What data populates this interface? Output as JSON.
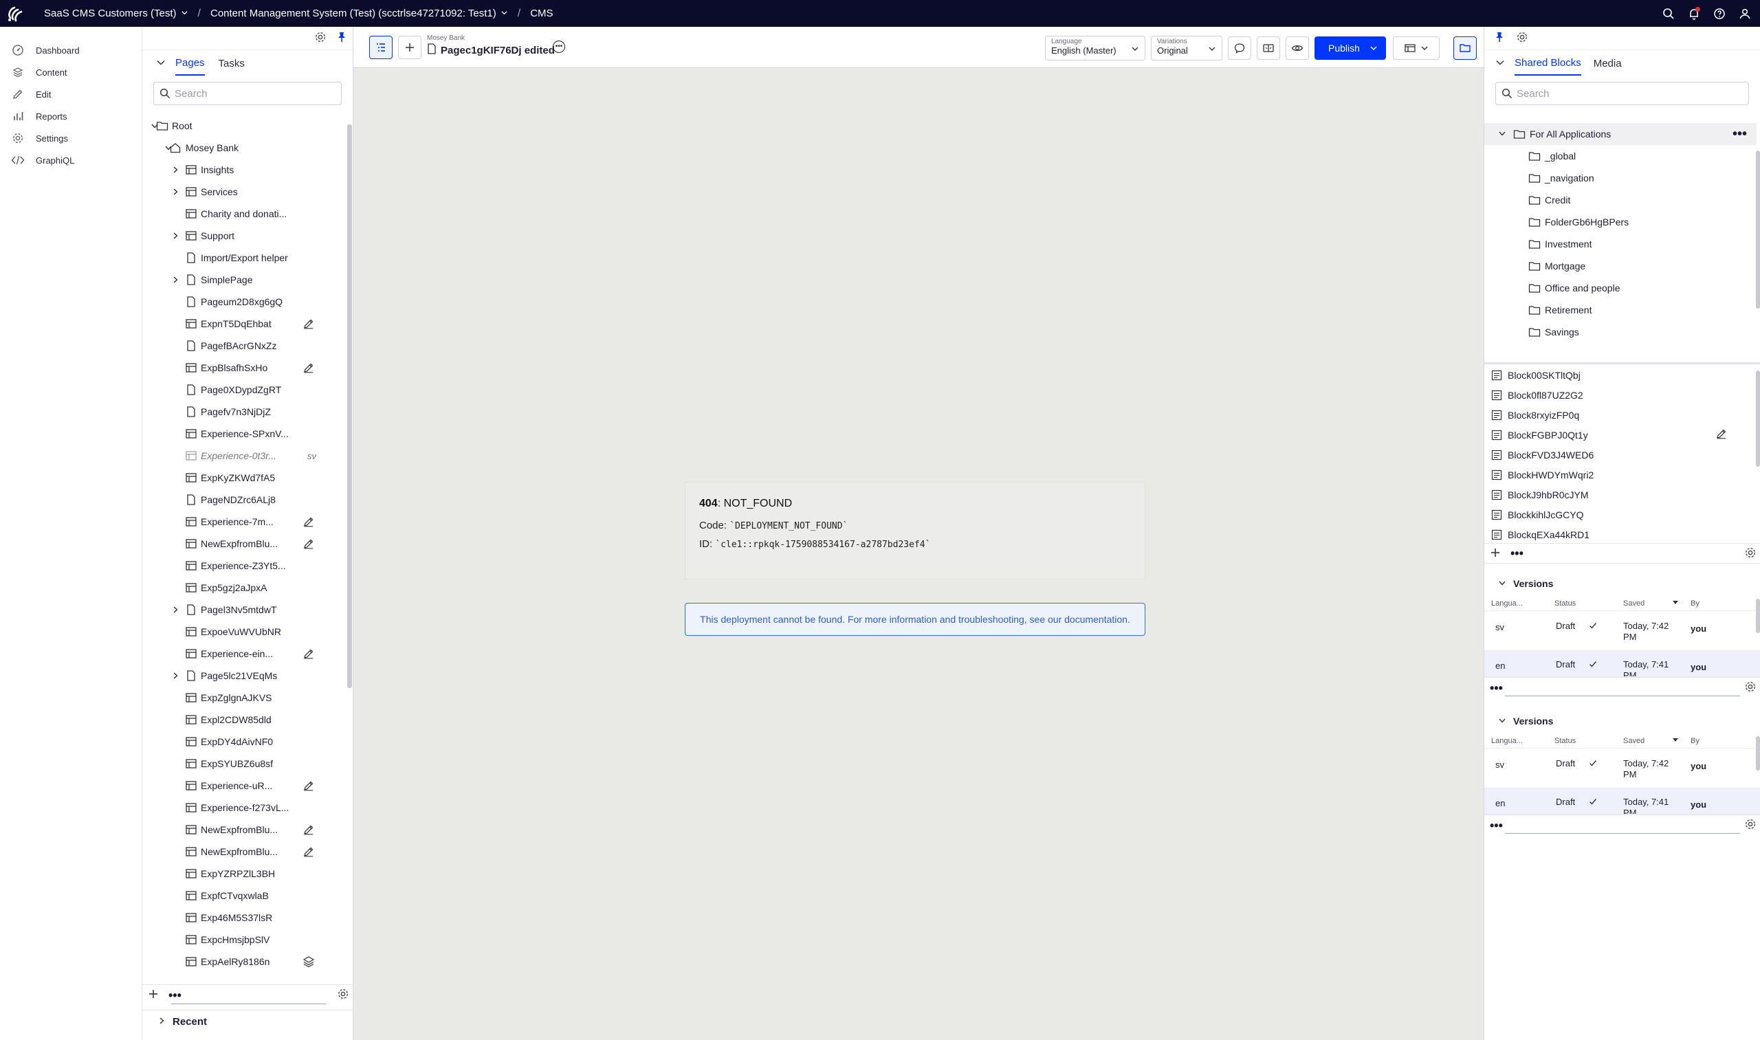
{
  "topbar": {
    "crumbs": [
      {
        "label": "SaaS CMS Customers (Test)",
        "dropdown": true
      },
      {
        "label": "Content Management System (Test) (scctrlse47271092: Test1)",
        "dropdown": true
      },
      {
        "label": "CMS",
        "dropdown": false
      }
    ]
  },
  "leftnav": {
    "items": [
      {
        "label": "Dashboard",
        "icon": "dashboard-icon"
      },
      {
        "label": "Content",
        "icon": "content-icon"
      },
      {
        "label": "Edit",
        "icon": "edit-icon"
      },
      {
        "label": "Reports",
        "icon": "reports-icon"
      },
      {
        "label": "Settings",
        "icon": "settings-icon"
      },
      {
        "label": "GraphiQL",
        "icon": "code-icon"
      }
    ]
  },
  "treepanel": {
    "tabs": {
      "pages": "Pages",
      "tasks": "Tasks"
    },
    "search_placeholder": "Search",
    "recent_label": "Recent",
    "items": [
      {
        "label": "Root",
        "level": 0,
        "icon": "folder",
        "expanded": true
      },
      {
        "label": "Mosey Bank",
        "level": 1,
        "icon": "home",
        "expanded": true
      },
      {
        "label": "Insights",
        "level": 2,
        "icon": "grid",
        "collapsed": true
      },
      {
        "label": "Services",
        "level": 2,
        "icon": "grid",
        "collapsed": true
      },
      {
        "label": "Charity and donati...",
        "level": 2,
        "icon": "grid"
      },
      {
        "label": "Support",
        "level": 2,
        "icon": "grid",
        "collapsed": true
      },
      {
        "label": "Import/Export helper",
        "level": 2,
        "icon": "page"
      },
      {
        "label": "SimplePage",
        "level": 2,
        "icon": "page",
        "collapsed": true
      },
      {
        "label": "Pageum2D8xg6gQ",
        "level": 2,
        "icon": "page"
      },
      {
        "label": "ExpnT5DqEhbat",
        "level": 2,
        "icon": "grid",
        "edit": true
      },
      {
        "label": "PagefBAcrGNxZz",
        "level": 2,
        "icon": "page"
      },
      {
        "label": "ExpBlsafhSxHo",
        "level": 2,
        "icon": "grid",
        "edit": true
      },
      {
        "label": "Page0XDypdZgRT",
        "level": 2,
        "icon": "page"
      },
      {
        "label": "Pagefv7n3NjDjZ",
        "level": 2,
        "icon": "page"
      },
      {
        "label": "Experience-SPxnV...",
        "level": 2,
        "icon": "grid"
      },
      {
        "label": "Experience-0t3r...",
        "level": 2,
        "icon": "grid",
        "italic": true,
        "tag": "sv"
      },
      {
        "label": "ExpKyZKWd7fA5",
        "level": 2,
        "icon": "grid"
      },
      {
        "label": "PageNDZrc6ALj8",
        "level": 2,
        "icon": "page"
      },
      {
        "label": "Experience-7m...",
        "level": 2,
        "icon": "grid",
        "edit": true
      },
      {
        "label": "NewExpfromBlu...",
        "level": 2,
        "icon": "grid",
        "edit": true
      },
      {
        "label": "Experience-Z3Yt5...",
        "level": 2,
        "icon": "grid"
      },
      {
        "label": "Exp5gzj2aJpxA",
        "level": 2,
        "icon": "grid"
      },
      {
        "label": "Pagel3Nv5mtdwT",
        "level": 2,
        "icon": "page",
        "collapsed": true
      },
      {
        "label": "ExpoeVuWVUbNR",
        "level": 2,
        "icon": "grid"
      },
      {
        "label": "Experience-ein...",
        "level": 2,
        "icon": "grid",
        "edit": true
      },
      {
        "label": "Page5lc21VEqMs",
        "level": 2,
        "icon": "page",
        "collapsed": true
      },
      {
        "label": "ExpZglgnAJKVS",
        "level": 2,
        "icon": "grid"
      },
      {
        "label": "Expl2CDW85dld",
        "level": 2,
        "icon": "grid"
      },
      {
        "label": "ExpDY4dAivNF0",
        "level": 2,
        "icon": "grid"
      },
      {
        "label": "ExpSYUBZ6u8sf",
        "level": 2,
        "icon": "grid"
      },
      {
        "label": "Experience-uR...",
        "level": 2,
        "icon": "grid",
        "edit": true
      },
      {
        "label": "Experience-f273vL...",
        "level": 2,
        "icon": "grid"
      },
      {
        "label": "NewExpfromBlu...",
        "level": 2,
        "icon": "grid",
        "edit": true
      },
      {
        "label": "NewExpfromBlu...",
        "level": 2,
        "icon": "grid",
        "edit": true
      },
      {
        "label": "ExpYZRPZlL3BH",
        "level": 2,
        "icon": "grid"
      },
      {
        "label": "ExpfCTvqxwlaB",
        "level": 2,
        "icon": "grid"
      },
      {
        "label": "Exp46M5S37lsR",
        "level": 2,
        "icon": "grid"
      },
      {
        "label": "ExpcHmsjbpSlV",
        "level": 2,
        "icon": "grid"
      },
      {
        "label": "ExpAelRy8186n",
        "level": 2,
        "icon": "grid",
        "layers": true
      }
    ]
  },
  "editor": {
    "parent": "Mosey Bank",
    "title": "Pagec1gKIF76Dj edited",
    "language": {
      "label": "Language",
      "value": "English (Master)"
    },
    "variations": {
      "label": "Variations",
      "value": "Original"
    },
    "publish_label": "Publish",
    "error": {
      "code_num": "404",
      "title_rest": ": NOT_FOUND",
      "code_label": "Code: ",
      "code_value": "`DEPLOYMENT_NOT_FOUND`",
      "id_label": "ID: ",
      "id_value": "`cle1::rpkqk-1759088534167-a2787bd23ef4`",
      "note": "This deployment cannot be found. For more information and troubleshooting, see our documentation."
    }
  },
  "rightpanel": {
    "tabs": {
      "shared": "Shared Blocks",
      "media": "Media"
    },
    "search_placeholder": "Search",
    "folders": [
      {
        "label": "For All Applications",
        "root": true
      },
      {
        "label": "_global"
      },
      {
        "label": "_navigation"
      },
      {
        "label": "Credit"
      },
      {
        "label": "FolderGb6HgBPers"
      },
      {
        "label": "Investment"
      },
      {
        "label": "Mortgage"
      },
      {
        "label": "Office and people"
      },
      {
        "label": "Retirement"
      },
      {
        "label": "Savings"
      }
    ],
    "blocks": [
      {
        "label": "Block00SKTltQbj"
      },
      {
        "label": "Block0fl87UZ2G2"
      },
      {
        "label": "Block8rxyizFP0q"
      },
      {
        "label": "BlockFGBPJ0Qt1y",
        "edit": true
      },
      {
        "label": "BlockFVD3J4WED6"
      },
      {
        "label": "BlockHWDYmWqri2"
      },
      {
        "label": "BlockJ9hbR0cJYM"
      },
      {
        "label": "BlockkihlJcGCYQ"
      },
      {
        "label": "BlockqEXa44kRD1"
      }
    ],
    "versions_title": "Versions",
    "version_cols": {
      "lang": "Langua...",
      "status": "Status",
      "saved": "Saved",
      "by": "By"
    },
    "versions_a": [
      {
        "lang": "sv",
        "status": "Draft",
        "saved1": "Today, 7:42",
        "saved2": "PM",
        "by": "you"
      },
      {
        "lang": "en",
        "status": "Draft",
        "saved1": "Today, 7:41",
        "saved2": "PM",
        "by": "you"
      }
    ],
    "versions_b": [
      {
        "lang": "sv",
        "status": "Draft",
        "saved1": "Today, 7:42",
        "saved2": "PM",
        "by": "you"
      },
      {
        "lang": "en",
        "status": "Draft",
        "saved1": "Today, 7:41",
        "saved2": "PM",
        "by": "you"
      }
    ]
  },
  "colors": {
    "accent": "#0037ff",
    "topbar": "#0b0b2b",
    "canvas": "#e9e9e6"
  }
}
